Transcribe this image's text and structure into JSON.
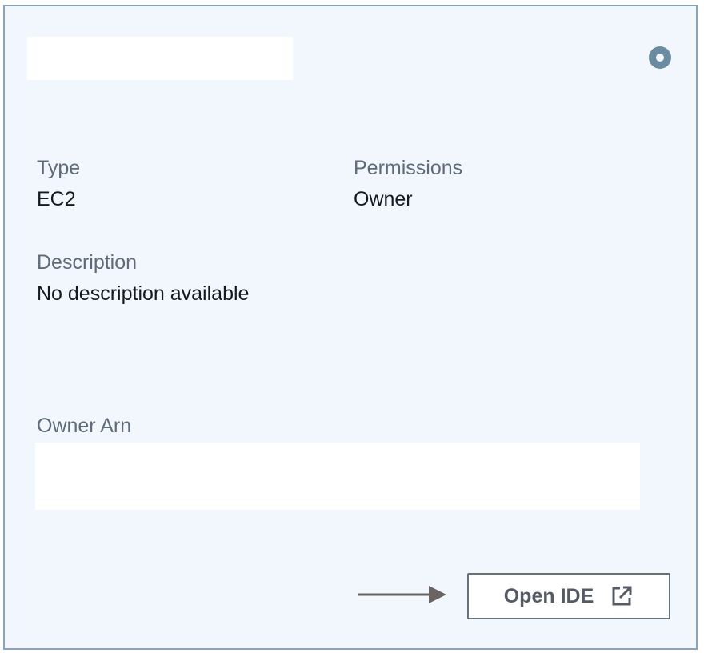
{
  "card": {
    "name": "",
    "status_icon": "status-circle-icon",
    "fields": {
      "type": {
        "label": "Type",
        "value": "EC2"
      },
      "permissions": {
        "label": "Permissions",
        "value": "Owner"
      },
      "description": {
        "label": "Description",
        "value": "No description available"
      },
      "owner_arn": {
        "label": "Owner Arn",
        "value": ""
      }
    },
    "open_ide_button": {
      "label": "Open IDE",
      "icon": "external-link-icon"
    }
  },
  "annotation": {
    "arrow_icon": "arrow-right-icon"
  },
  "colors": {
    "card_background": "#f2f7fd",
    "card_border": "#8aa4bb",
    "label_text": "#5f6b7a",
    "value_text": "#16191f",
    "status_icon": "#6a8ba1",
    "button_border": "#687078",
    "button_text": "#545b64",
    "arrow": "#6b6465"
  }
}
